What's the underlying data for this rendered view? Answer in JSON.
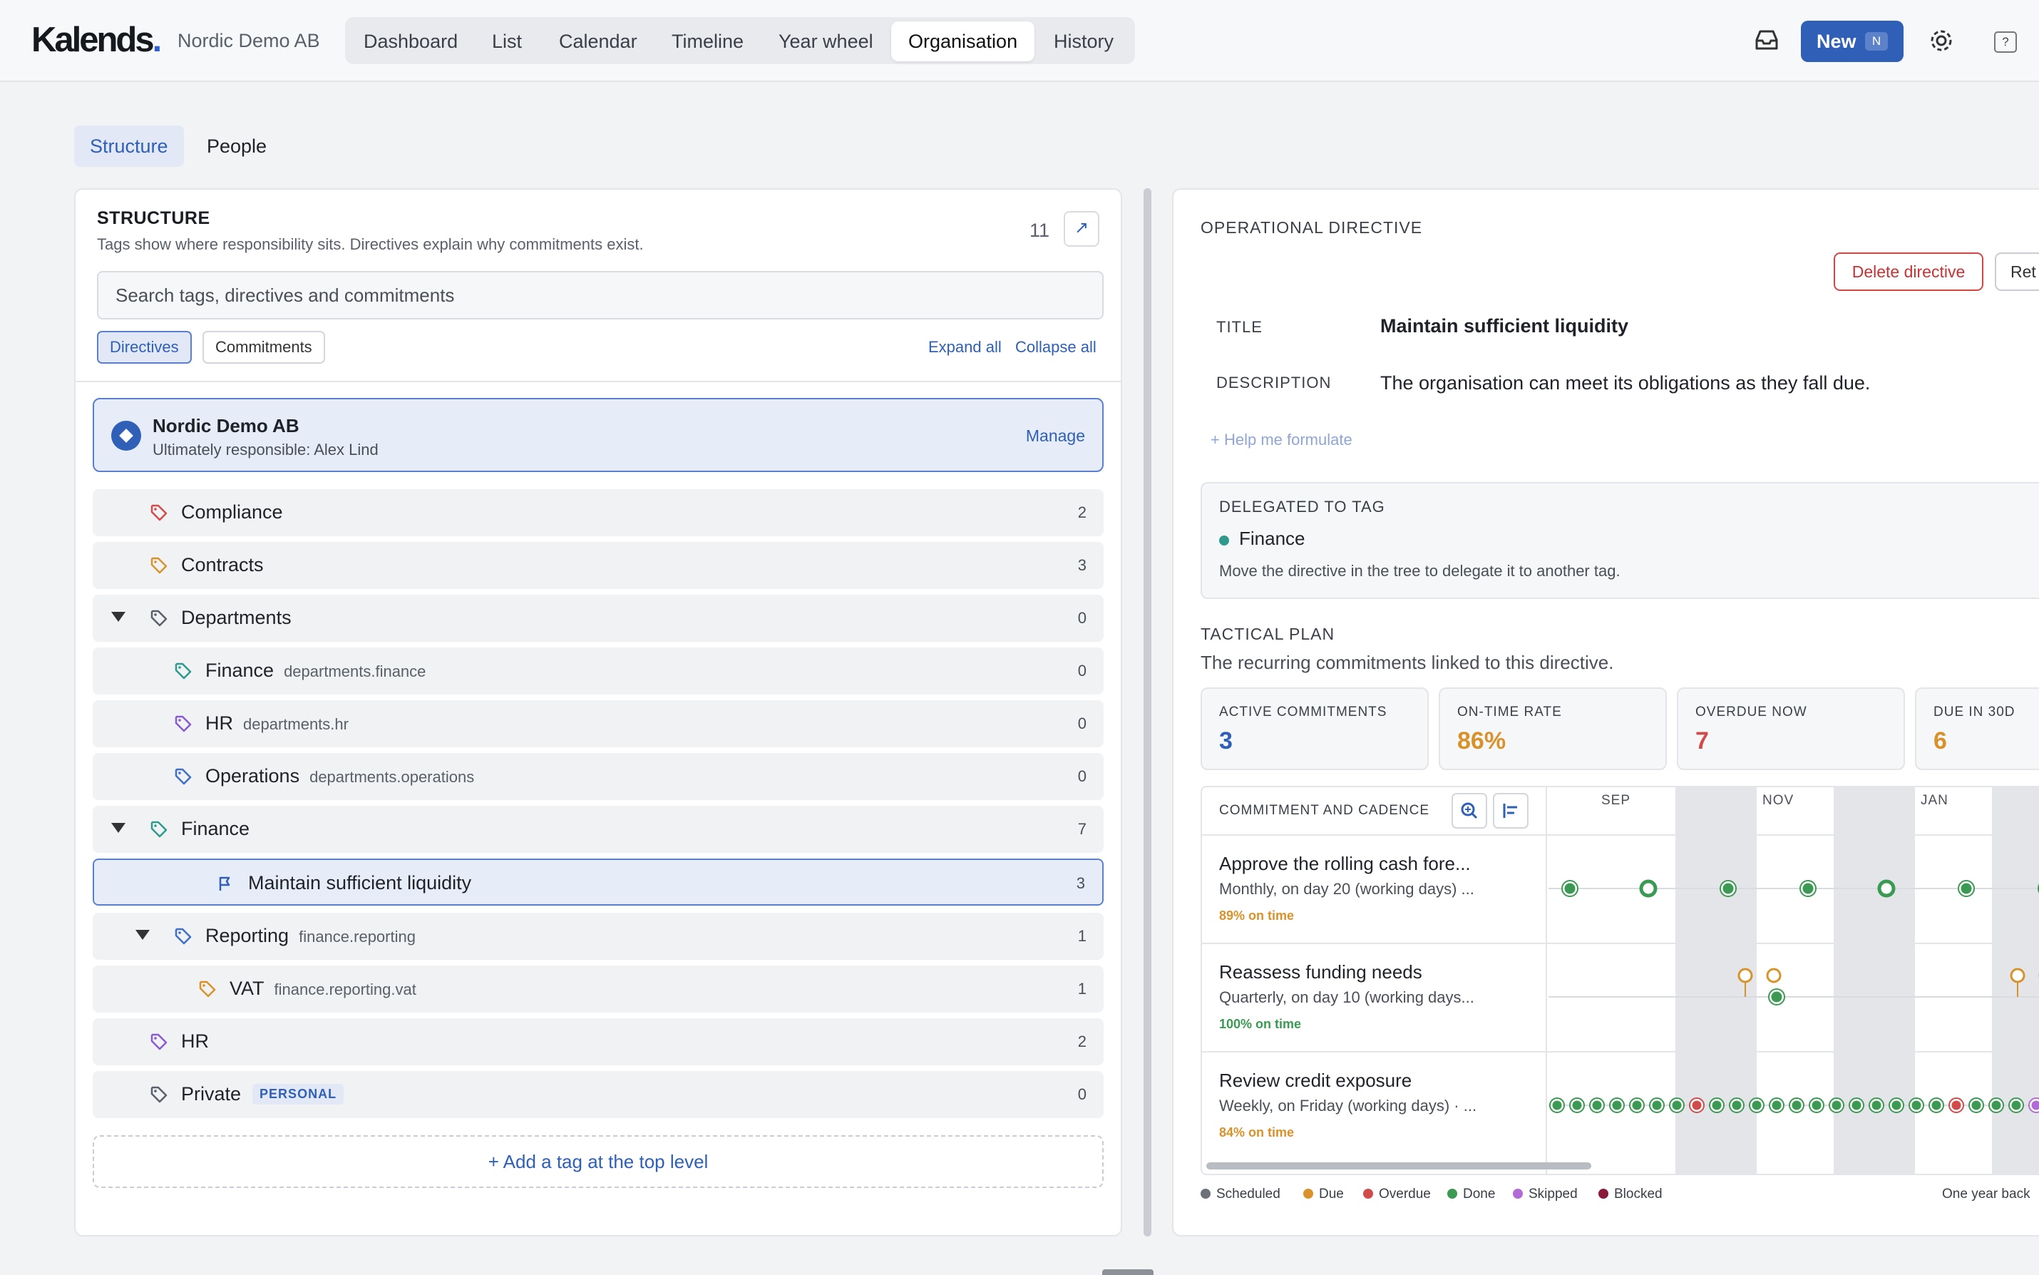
{
  "app": {
    "logo": "Kalends",
    "org": "Nordic Demo AB"
  },
  "nav": [
    "Dashboard",
    "List",
    "Calendar",
    "Timeline",
    "Year wheel",
    "Organisation",
    "History"
  ],
  "nav_active": "Organisation",
  "toolbar": {
    "new_label": "New",
    "new_shortcut": "N",
    "help": "?"
  },
  "subtabs": [
    "Structure",
    "People"
  ],
  "structure": {
    "title": "STRUCTURE",
    "subtitle": "Tags show where responsibility sits. Directives explain why commitments exist.",
    "count": "11",
    "expand_icon": "↗",
    "search_placeholder": "Search tags, directives and commitments",
    "filters": [
      "Directives",
      "Commitments"
    ],
    "expand_all": "Expand all",
    "collapse_all": "Collapse all",
    "root": {
      "title": "Nordic Demo AB",
      "subtitle": "Ultimately responsible: Alex Lind",
      "manage": "Manage"
    },
    "rows": [
      {
        "label": "Compliance",
        "slug": "",
        "count": "2",
        "color": "#d24b4b",
        "type": "tag"
      },
      {
        "label": "Contracts",
        "slug": "",
        "count": "3",
        "color": "#d9922a",
        "type": "tag"
      },
      {
        "label": "Departments",
        "slug": "",
        "count": "0",
        "color": "#5a606a",
        "type": "tag"
      },
      {
        "label": "Finance",
        "slug": "departments.finance",
        "count": "0",
        "color": "#2e9a8e",
        "type": "tag"
      },
      {
        "label": "HR",
        "slug": "departments.hr",
        "count": "0",
        "color": "#8a5ad0",
        "type": "tag"
      },
      {
        "label": "Operations",
        "slug": "departments.operations",
        "count": "0",
        "color": "#3f6fc6",
        "type": "tag"
      },
      {
        "label": "Finance",
        "slug": "",
        "count": "7",
        "color": "#2e9a8e",
        "type": "tag"
      },
      {
        "label": "Maintain sufficient liquidity",
        "slug": "",
        "count": "3",
        "color": "#2f5fb7",
        "type": "directive"
      },
      {
        "label": "Reporting",
        "slug": "finance.reporting",
        "count": "1",
        "color": "#3f6fc6",
        "type": "tag"
      },
      {
        "label": "VAT",
        "slug": "finance.reporting.vat",
        "count": "1",
        "color": "#d9922a",
        "type": "tag"
      },
      {
        "label": "HR",
        "slug": "",
        "count": "2",
        "color": "#8a5ad0",
        "type": "tag"
      },
      {
        "label": "Private",
        "slug": "",
        "count": "0",
        "color": "#5a606a",
        "type": "tag",
        "badge": "PERSONAL"
      }
    ],
    "add_tag": "+ Add a tag at the top level"
  },
  "directive": {
    "header": "OPERATIONAL DIRECTIVE",
    "delete_label": "Delete directive",
    "ret_label": "Ret",
    "title_label": "TITLE",
    "title": "Maintain sufficient liquidity",
    "desc_label": "DESCRIPTION",
    "description": "The organisation can meet its obligations as they fall due.",
    "help_me": "+ Help me formulate",
    "delegated_label": "DELEGATED TO TAG",
    "delegated_tag": "Finance",
    "delegated_note": "Move the directive in the tree to delegate it to another tag.",
    "tactical_label": "TACTICAL PLAN",
    "tactical_sub": "The recurring commitments linked to this directive.",
    "kpis": [
      {
        "label": "ACTIVE COMMITMENTS",
        "value": "3",
        "color": "#2f5fb7"
      },
      {
        "label": "ON-TIME RATE",
        "value": "86%",
        "color": "#d9922a"
      },
      {
        "label": "OVERDUE NOW",
        "value": "7",
        "color": "#d24b4b"
      },
      {
        "label": "DUE IN 30D",
        "value": "6",
        "color": "#d9922a"
      }
    ],
    "gantt_header": "COMMITMENT AND CADENCE",
    "months": [
      "SEP",
      "NOV",
      "JAN"
    ],
    "commitments": [
      {
        "title": "Approve the rolling cash fore...",
        "cadence": "Monthly, on day 20 (working days) ...",
        "rate": "89% on time",
        "rate_color": "#d9922a"
      },
      {
        "title": "Reassess funding needs",
        "cadence": "Quarterly, on day 10 (working days...",
        "rate": "100% on time",
        "rate_color": "#3a9a52"
      },
      {
        "title": "Review credit exposure",
        "cadence": "Weekly, on Friday (working days) · ...",
        "rate": "84% on time",
        "rate_color": "#d9922a"
      }
    ],
    "legend": [
      {
        "label": "Scheduled",
        "color": "#6b7079"
      },
      {
        "label": "Due",
        "color": "#d9922a"
      },
      {
        "label": "Overdue",
        "color": "#d24b4b"
      },
      {
        "label": "Done",
        "color": "#3a9a52"
      },
      {
        "label": "Skipped",
        "color": "#b26ad6"
      },
      {
        "label": "Blocked",
        "color": "#8a1a3a"
      }
    ],
    "range_label": "One year back"
  }
}
